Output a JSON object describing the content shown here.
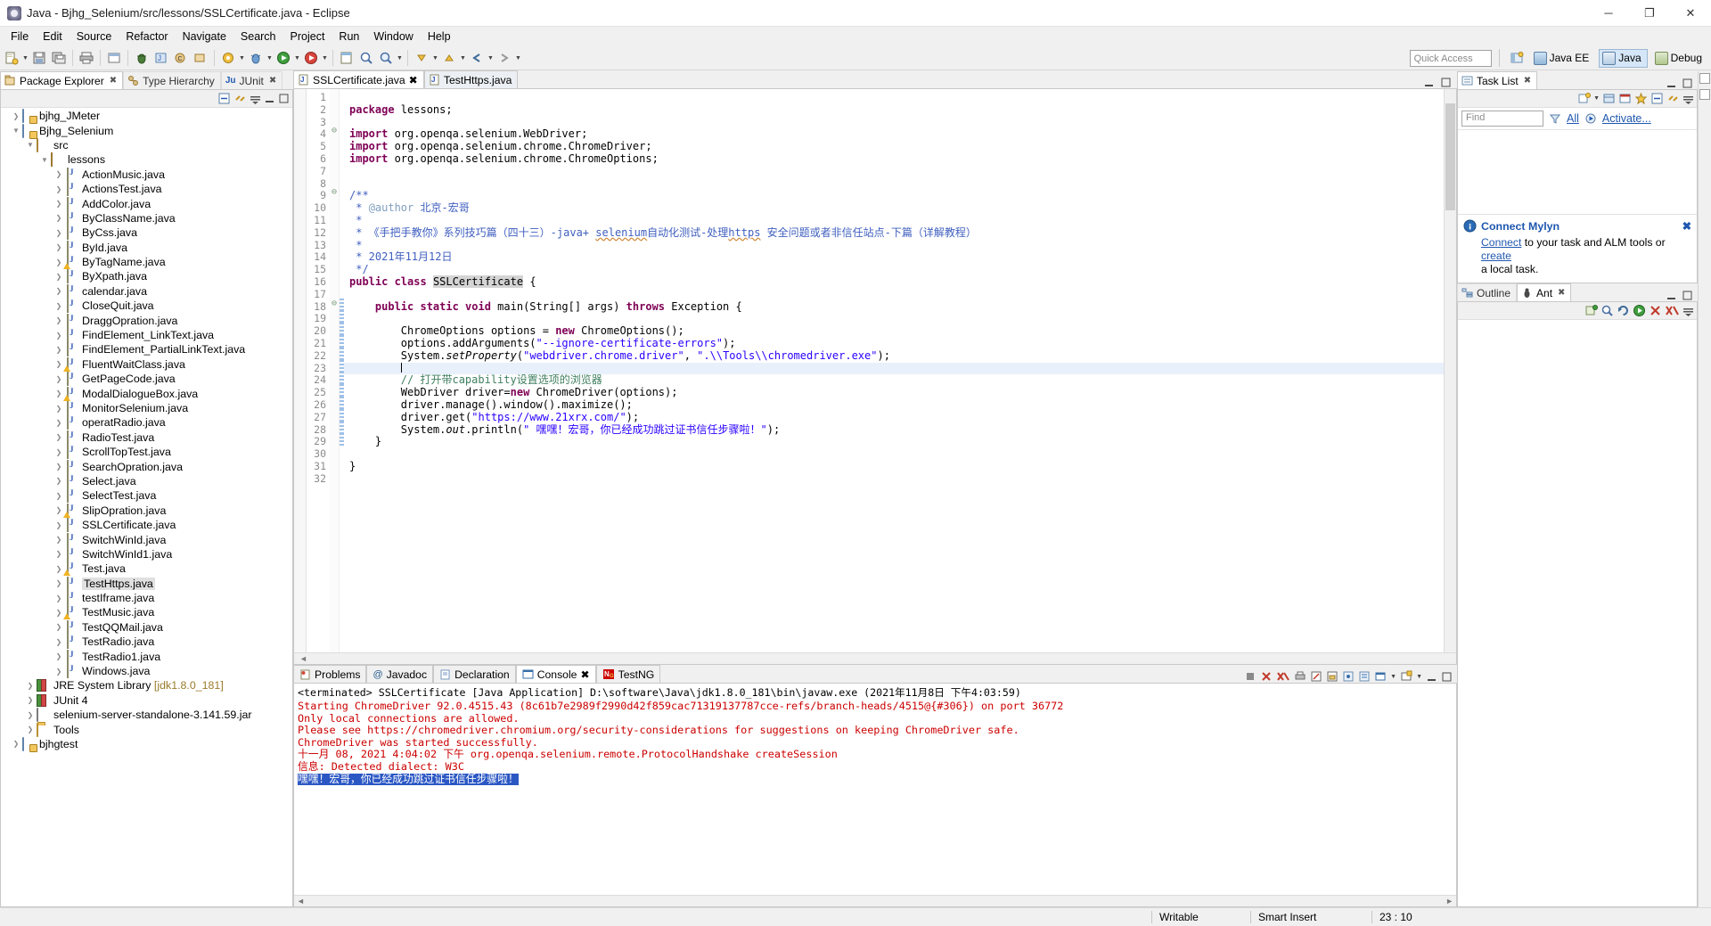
{
  "window": {
    "title": "Java - Bjhg_Selenium/src/lessons/SSLCertificate.java - Eclipse",
    "minimize": "─",
    "maximize": "❐",
    "close": "✕"
  },
  "menubar": [
    "File",
    "Edit",
    "Source",
    "Refactor",
    "Navigate",
    "Search",
    "Project",
    "Run",
    "Window",
    "Help"
  ],
  "toolbar": {
    "quick_access_placeholder": "Quick Access",
    "perspectives": [
      {
        "label": "Java EE",
        "active": false
      },
      {
        "label": "Java",
        "active": true
      },
      {
        "label": "Debug",
        "active": false
      }
    ]
  },
  "left_panel": {
    "tabs": [
      {
        "label": "Package Explorer",
        "selected": true,
        "closable": true
      },
      {
        "label": "Type Hierarchy",
        "selected": false,
        "closable": false
      },
      {
        "label": "JUnit",
        "selected": false,
        "closable": true
      }
    ],
    "tree": [
      {
        "label": "bjhg_JMeter",
        "depth": 0,
        "icon": "project-icon",
        "expanded": false,
        "arrow": true
      },
      {
        "label": "Bjhg_Selenium",
        "depth": 0,
        "icon": "project-icon",
        "expanded": true,
        "arrow": true
      },
      {
        "label": "src",
        "depth": 1,
        "icon": "source-folder-icon",
        "expanded": true,
        "arrow": true
      },
      {
        "label": "lessons",
        "depth": 2,
        "icon": "package-icon",
        "expanded": true,
        "arrow": true
      },
      {
        "label": "ActionMusic.java",
        "depth": 3,
        "icon": "java-file-icon",
        "arrow": true
      },
      {
        "label": "ActionsTest.java",
        "depth": 3,
        "icon": "java-file-icon",
        "arrow": true
      },
      {
        "label": "AddColor.java",
        "depth": 3,
        "icon": "java-file-icon",
        "arrow": true
      },
      {
        "label": "ByClassName.java",
        "depth": 3,
        "icon": "java-file-icon",
        "arrow": true
      },
      {
        "label": "ByCss.java",
        "depth": 3,
        "icon": "java-file-icon",
        "arrow": true
      },
      {
        "label": "ById.java",
        "depth": 3,
        "icon": "java-file-icon",
        "arrow": true
      },
      {
        "label": "ByTagName.java",
        "depth": 3,
        "icon": "java-file-warning-icon",
        "warn": true,
        "arrow": true
      },
      {
        "label": "ByXpath.java",
        "depth": 3,
        "icon": "java-file-icon",
        "arrow": true
      },
      {
        "label": "calendar.java",
        "depth": 3,
        "icon": "java-file-icon",
        "arrow": true
      },
      {
        "label": "CloseQuit.java",
        "depth": 3,
        "icon": "java-file-icon",
        "arrow": true
      },
      {
        "label": "DraggOpration.java",
        "depth": 3,
        "icon": "java-file-icon",
        "arrow": true
      },
      {
        "label": "FindElement_LinkText.java",
        "depth": 3,
        "icon": "java-file-icon",
        "arrow": true
      },
      {
        "label": "FindElement_PartialLinkText.java",
        "depth": 3,
        "icon": "java-file-icon",
        "arrow": true
      },
      {
        "label": "FluentWaitClass.java",
        "depth": 3,
        "icon": "java-file-warning-icon",
        "warn": true,
        "arrow": true
      },
      {
        "label": "GetPageCode.java",
        "depth": 3,
        "icon": "java-file-icon",
        "arrow": true
      },
      {
        "label": "ModalDialogueBox.java",
        "depth": 3,
        "icon": "java-file-warning-icon",
        "warn": true,
        "arrow": true
      },
      {
        "label": "MonitorSelenium.java",
        "depth": 3,
        "icon": "java-file-icon",
        "arrow": true
      },
      {
        "label": "operatRadio.java",
        "depth": 3,
        "icon": "java-file-icon",
        "arrow": true
      },
      {
        "label": "RadioTest.java",
        "depth": 3,
        "icon": "java-file-icon",
        "arrow": true
      },
      {
        "label": "ScrollTopTest.java",
        "depth": 3,
        "icon": "java-file-icon",
        "arrow": true
      },
      {
        "label": "SearchOpration.java",
        "depth": 3,
        "icon": "java-file-icon",
        "arrow": true
      },
      {
        "label": "Select.java",
        "depth": 3,
        "icon": "java-file-icon",
        "arrow": true
      },
      {
        "label": "SelectTest.java",
        "depth": 3,
        "icon": "java-file-icon",
        "arrow": true
      },
      {
        "label": "SlipOpration.java",
        "depth": 3,
        "icon": "java-file-warning-icon",
        "warn": true,
        "arrow": true
      },
      {
        "label": "SSLCertificate.java",
        "depth": 3,
        "icon": "java-file-icon",
        "arrow": true
      },
      {
        "label": "SwitchWinId.java",
        "depth": 3,
        "icon": "java-file-icon",
        "arrow": true
      },
      {
        "label": "SwitchWinId1.java",
        "depth": 3,
        "icon": "java-file-icon",
        "arrow": true
      },
      {
        "label": "Test.java",
        "depth": 3,
        "icon": "java-file-warning-icon",
        "warn": true,
        "arrow": true
      },
      {
        "label": "TestHttps.java",
        "depth": 3,
        "icon": "java-file-icon",
        "arrow": true,
        "selected": true
      },
      {
        "label": "testIframe.java",
        "depth": 3,
        "icon": "java-file-icon",
        "arrow": true
      },
      {
        "label": "TestMusic.java",
        "depth": 3,
        "icon": "java-file-warning-icon",
        "warn": true,
        "arrow": true
      },
      {
        "label": "TestQQMail.java",
        "depth": 3,
        "icon": "java-file-icon",
        "arrow": true
      },
      {
        "label": "TestRadio.java",
        "depth": 3,
        "icon": "java-file-icon",
        "arrow": true
      },
      {
        "label": "TestRadio1.java",
        "depth": 3,
        "icon": "java-file-icon",
        "arrow": true
      },
      {
        "label": "Windows.java",
        "depth": 3,
        "icon": "java-file-icon",
        "arrow": true
      },
      {
        "label": "JRE System Library ",
        "dim": "[jdk1.8.0_181]",
        "depth": 1,
        "icon": "library-icon",
        "arrow": true
      },
      {
        "label": "JUnit 4",
        "depth": 1,
        "icon": "library-icon",
        "arrow": true
      },
      {
        "label": "selenium-server-standalone-3.141.59.jar",
        "depth": 1,
        "icon": "jar-icon",
        "arrow": true
      },
      {
        "label": "Tools",
        "depth": 1,
        "icon": "folder-icon",
        "arrow": true
      },
      {
        "label": "bjhgtest",
        "depth": 0,
        "icon": "project-icon",
        "arrow": true
      }
    ]
  },
  "editor": {
    "tabs": [
      {
        "label": "SSLCertificate.java",
        "selected": true,
        "closable": true
      },
      {
        "label": "TestHttps.java",
        "selected": false,
        "closable": false
      }
    ],
    "lines": [
      {
        "n": 1,
        "html": ""
      },
      {
        "n": 2,
        "html": "<span class='kw'>package</span> lessons;"
      },
      {
        "n": 3,
        "html": ""
      },
      {
        "n": 4,
        "html": "<span class='kw'>import</span> org.openqa.selenium.WebDriver;",
        "fold": true
      },
      {
        "n": 5,
        "html": "<span class='kw'>import</span> org.openqa.selenium.chrome.ChromeDriver;"
      },
      {
        "n": 6,
        "html": "<span class='kw'>import</span> org.openqa.selenium.chrome.ChromeOptions;"
      },
      {
        "n": 7,
        "html": ""
      },
      {
        "n": 8,
        "html": ""
      },
      {
        "n": 9,
        "html": "<span class='jdoc'>/**</span>",
        "fold": true
      },
      {
        "n": 10,
        "html": " <span class='jdoc'>* </span><span class='jtag'>@author</span> <span class='jdoc'>北京-宏哥</span>"
      },
      {
        "n": 11,
        "html": " <span class='jdoc'>*</span>"
      },
      {
        "n": 12,
        "html": " <span class='jdoc'>* 《手把手教你》系列技巧篇（四十三）-java+ <span class='sq'>selenium</span>自动化测试-处理<span class='sq'>https</span> 安全问题或者非信任站点-下篇（详解教程）</span>"
      },
      {
        "n": 13,
        "html": " <span class='jdoc'>*</span>"
      },
      {
        "n": 14,
        "html": " <span class='jdoc'>* 2021年11月12日</span>"
      },
      {
        "n": 15,
        "html": " <span class='jdoc'>*/</span>"
      },
      {
        "n": 16,
        "html": "<span class='kw'>public class</span> <span class='hlname'>SSLCertificate</span> {"
      },
      {
        "n": 17,
        "html": ""
      },
      {
        "n": 18,
        "html": "    <span class='kw'>public static void</span> main(String[] args) <span class='kw'>throws</span> Exception {",
        "fold": true,
        "bar": true
      },
      {
        "n": 19,
        "html": "",
        "bar": true
      },
      {
        "n": 20,
        "html": "        ChromeOptions options = <span class='kw'>new</span> ChromeOptions();",
        "bar": true
      },
      {
        "n": 21,
        "html": "        options.addArguments(<span class='str'>\"--ignore-certificate-errors\"</span>);",
        "bar": true
      },
      {
        "n": 22,
        "html": "        System.<span class='ital'>setProperty</span>(<span class='str'>\"webdriver.chrome.driver\"</span>, <span class='str'>\".\\\\Tools\\\\chromedriver.exe\"</span>);",
        "bar": true
      },
      {
        "n": 23,
        "html": "        <span class='caret'></span>",
        "bar": true,
        "highlight": true
      },
      {
        "n": 24,
        "html": "        <span class='cmt'>// 打开带capability设置选项的浏览器</span>",
        "bar": true
      },
      {
        "n": 25,
        "html": "        WebDriver driver=<span class='kw'>new</span> ChromeDriver(options);",
        "bar": true
      },
      {
        "n": 26,
        "html": "        driver.manage().window().maximize();",
        "bar": true
      },
      {
        "n": 27,
        "html": "        driver.get(<span class='str'>\"https://www.21xrx.com/\"</span>);",
        "bar": true
      },
      {
        "n": 28,
        "html": "        System.<span class='ital'>out</span>.println(<span class='str'>\" 嘿嘿！宏哥，你已经成功跳过证书信任步骤啦！\"</span>);",
        "bar": true
      },
      {
        "n": 29,
        "html": "    }",
        "bar": true
      },
      {
        "n": 30,
        "html": ""
      },
      {
        "n": 31,
        "html": "}"
      },
      {
        "n": 32,
        "html": ""
      }
    ]
  },
  "console": {
    "tabs": [
      {
        "label": "Problems",
        "selected": false,
        "icon": "problems-icon"
      },
      {
        "label": "Javadoc",
        "selected": false,
        "icon": "javadoc-icon"
      },
      {
        "label": "Declaration",
        "selected": false,
        "icon": "declaration-icon"
      },
      {
        "label": "Console",
        "selected": true,
        "icon": "console-icon",
        "closable": true
      },
      {
        "label": "TestNG",
        "selected": false,
        "icon": "testng-icon"
      }
    ],
    "header": "<terminated> SSLCertificate [Java Application] D:\\software\\Java\\jdk1.8.0_181\\bin\\javaw.exe (2021年11月8日 下午4:03:59)",
    "output": [
      {
        "text": "Starting ChromeDriver 92.0.4515.43 (8c61b7e2989f2990d42f859cac71319137787cce-refs/branch-heads/4515@{#306}) on port 36772",
        "style": "err"
      },
      {
        "text": "Only local connections are allowed.",
        "style": "err"
      },
      {
        "text": "Please see https://chromedriver.chromium.org/security-considerations for suggestions on keeping ChromeDriver safe.",
        "style": "err"
      },
      {
        "text": "ChromeDriver was started successfully.",
        "style": "err"
      },
      {
        "text": "十一月 08, 2021 4:04:02 下午 org.openqa.selenium.remote.ProtocolHandshake createSession",
        "style": "err"
      },
      {
        "text": "信息: Detected dialect: W3C",
        "style": "err"
      },
      {
        "text": "嘿嘿！宏哥，你已经成功跳过证书信任步骤啦！",
        "style": "selected"
      }
    ]
  },
  "task_list": {
    "tabs": [
      {
        "label": "Task List",
        "selected": true,
        "closable": true
      }
    ],
    "find_placeholder": "Find",
    "all_label": "All",
    "activate_label": "Activate...",
    "mylyn": {
      "title": "Connect Mylyn",
      "line1_prefix": "",
      "connect_link": "Connect",
      "line1_mid": " to your task and ALM tools or ",
      "create_link": "create",
      "line2": "a local task."
    }
  },
  "outline": {
    "tabs": [
      {
        "label": "Outline",
        "selected": false
      },
      {
        "label": "Ant",
        "selected": true,
        "closable": true
      }
    ]
  },
  "statusbar": {
    "writable": "Writable",
    "insert_mode": "Smart Insert",
    "position": "23 : 10"
  },
  "colors": {
    "accent_blue": "#2058b0",
    "console_error": "#cc0000",
    "selection_blue": "#2b57c4",
    "keyword_purple": "#7f0055",
    "string_blue": "#2a00ff",
    "comment_green": "#3f7f5f",
    "javadoc_blue": "#3f5fbf"
  }
}
